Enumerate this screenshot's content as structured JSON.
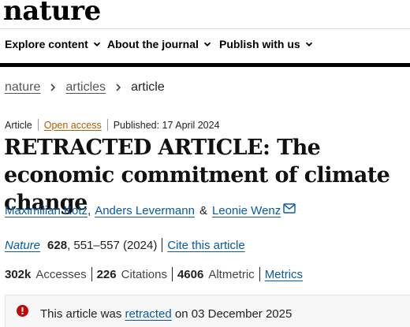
{
  "brand": {
    "logo_text": "nature"
  },
  "nav": {
    "items": [
      {
        "label": "Explore content",
        "icon": "chevron-down-icon"
      },
      {
        "label": "About the journal",
        "icon": "chevron-down-icon"
      },
      {
        "label": "Publish with us",
        "icon": "chevron-down-icon"
      }
    ]
  },
  "breadcrumb": {
    "items": [
      "nature",
      "articles"
    ],
    "current": "article",
    "separator_icon": "chevron-right-icon"
  },
  "meta": {
    "type": "Article",
    "access": "Open access",
    "published": "Published: 17 April 2024"
  },
  "article": {
    "title": "RETRACTED ARTICLE: The economic commitment of climate change",
    "authors": [
      "Maximilian Kotz",
      "Anders Levermann",
      "Leonie Wenz"
    ],
    "author_separator": ",",
    "author_conjunction": "&",
    "contact_icon": "envelope-icon"
  },
  "citation": {
    "journal": "Nature",
    "volume": "628",
    "pages_year": ", 551–557 (2024)",
    "cite_label": "Cite this article"
  },
  "metrics": {
    "accesses_value": "302k",
    "accesses_label": "Accesses",
    "citations_value": "226",
    "citations_label": "Citations",
    "altmetric_value": "4606",
    "altmetric_label": "Altmetric",
    "metrics_link": "Metrics"
  },
  "notice": {
    "icon": "alert-icon",
    "prefix": "This article was",
    "link": "retracted",
    "suffix": "on 03 December 2025"
  },
  "colors": {
    "link": "#0a5aa0",
    "open_access": "#b35c00",
    "alert": "#c40606",
    "rule": "#000000"
  }
}
